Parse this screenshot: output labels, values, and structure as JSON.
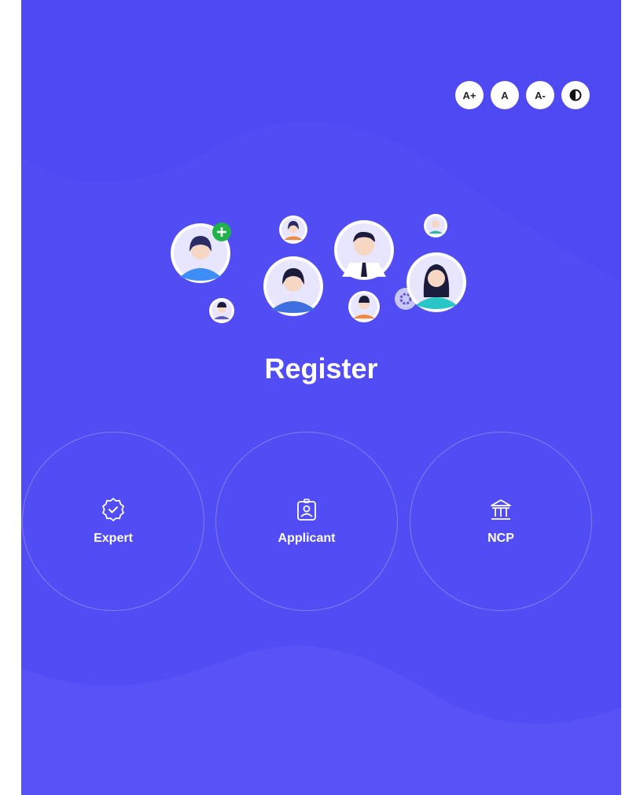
{
  "colors": {
    "background": "#4f49f3",
    "wave_light": "#5a55f6",
    "badge_green": "#21b24b",
    "white": "#ffffff"
  },
  "accessibility": {
    "font_increase": "A+",
    "font_default": "A",
    "font_decrease": "A-",
    "contrast_icon": "contrast-icon"
  },
  "page": {
    "title": "Register"
  },
  "options": [
    {
      "label": "Expert",
      "icon": "badge-check-icon"
    },
    {
      "label": "Applicant",
      "icon": "id-badge-icon"
    },
    {
      "label": "NCP",
      "icon": "institution-icon"
    }
  ]
}
